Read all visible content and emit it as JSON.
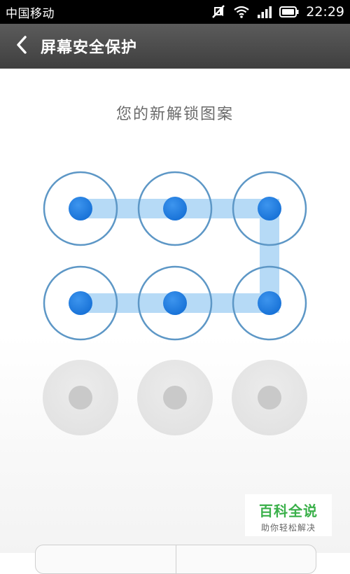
{
  "status_bar": {
    "carrier": "中国移动",
    "time": "22:29",
    "icons": [
      "silent-icon",
      "wifi-icon",
      "signal-icon",
      "battery-icon"
    ]
  },
  "header": {
    "title": "屏幕安全保护",
    "back_icon": "chevron-left-icon"
  },
  "main": {
    "prompt": "您的新解锁图案",
    "grid_size": 3,
    "selected_nodes": [
      1,
      2,
      3,
      4,
      5,
      6
    ],
    "pattern_path": [
      1,
      2,
      3,
      6,
      5,
      4
    ],
    "colors": {
      "active_dot": "#1f7fe0",
      "active_ring": "#5d97c6",
      "line": "#a9d3f5",
      "idle_disc": "#e4e4e4",
      "idle_dot": "#c9c9c9"
    }
  },
  "watermark": {
    "main": "百科全说",
    "sub": "助你轻松解决"
  }
}
